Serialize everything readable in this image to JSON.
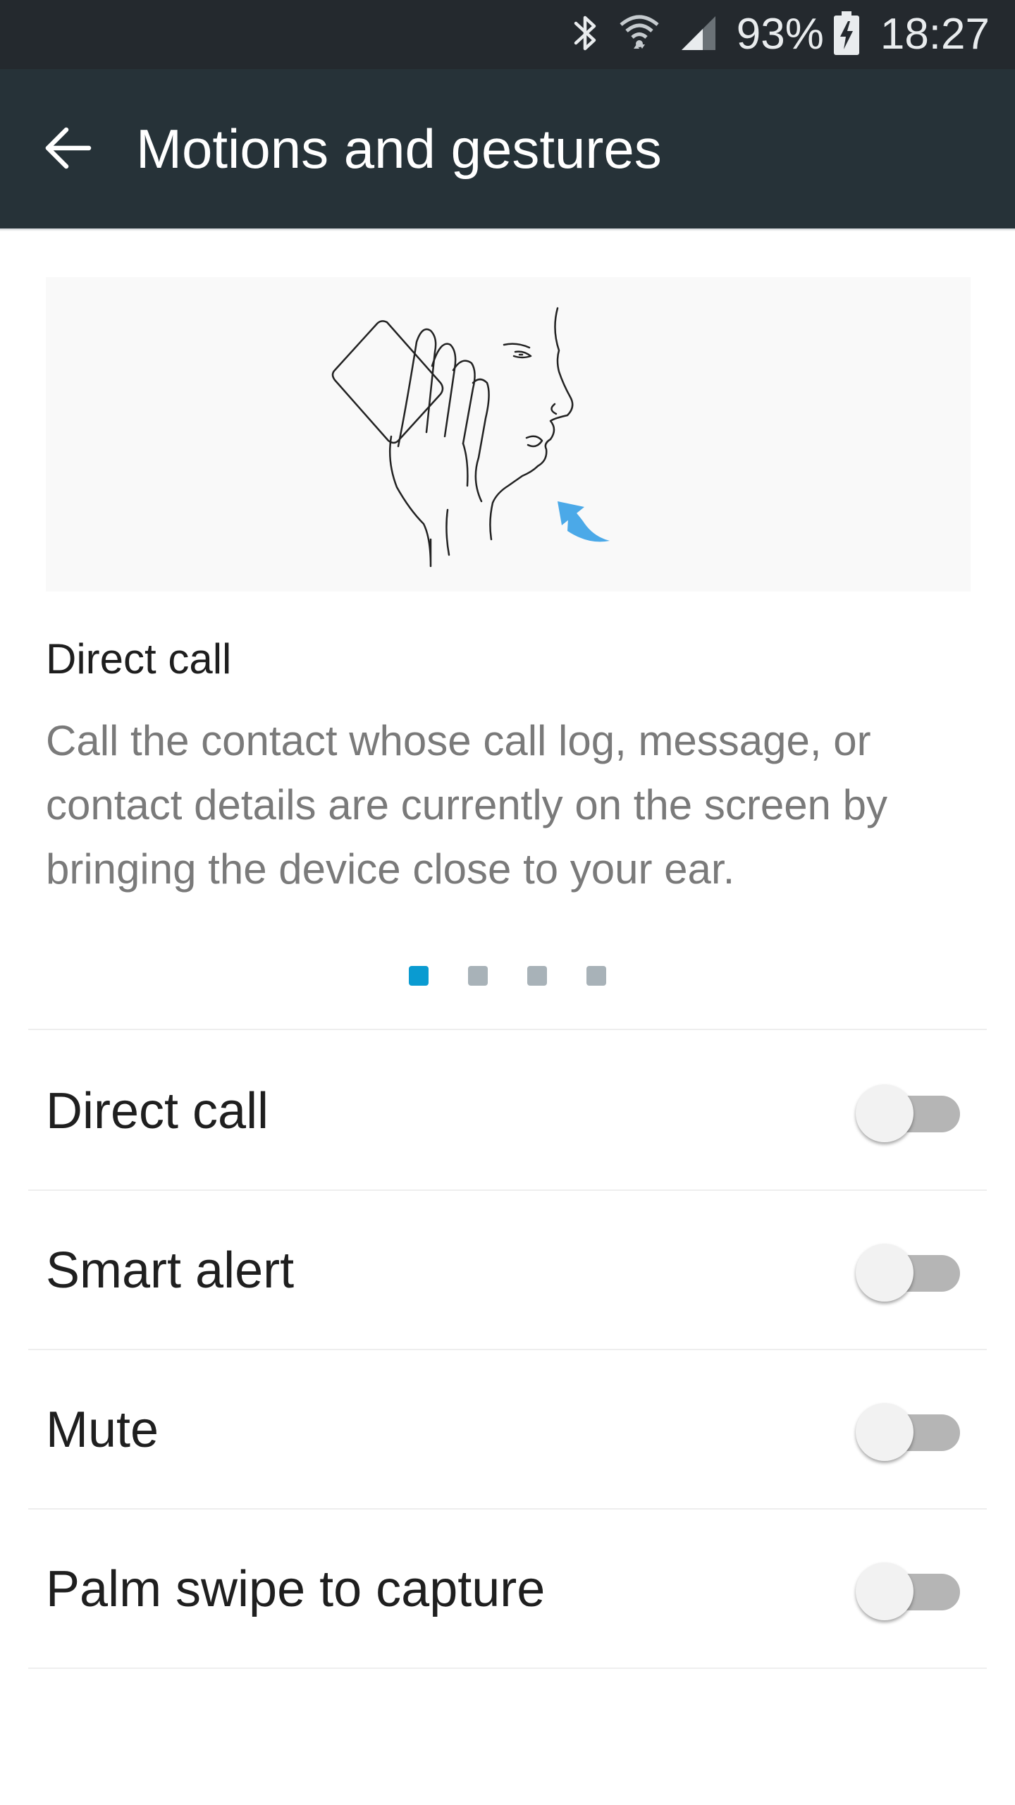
{
  "status_bar": {
    "battery_percent": "93%",
    "time": "18:27",
    "icons": [
      "bluetooth-icon",
      "wifi-icon",
      "signal-icon",
      "battery-charging-icon"
    ]
  },
  "app_bar": {
    "title": "Motions and gestures",
    "back_icon": "back-arrow-icon"
  },
  "colors": {
    "status_bar_bg": "#24292e",
    "app_bar_bg": "#263238",
    "accent": "#0a9bd1",
    "dot_inactive": "#a8b2b8",
    "switch_track_off": "#b5b5b5"
  },
  "feature_card": {
    "illustration": "direct-call-illustration",
    "title": "Direct call",
    "description": "Call the contact whose call log, message, or contact details are currently on the screen by bringing the device close to your ear.",
    "page_count": 4,
    "current_page": 1
  },
  "settings": [
    {
      "label": "Direct call",
      "enabled": false
    },
    {
      "label": "Smart alert",
      "enabled": false
    },
    {
      "label": "Mute",
      "enabled": false
    },
    {
      "label": "Palm swipe to capture",
      "enabled": false
    }
  ]
}
